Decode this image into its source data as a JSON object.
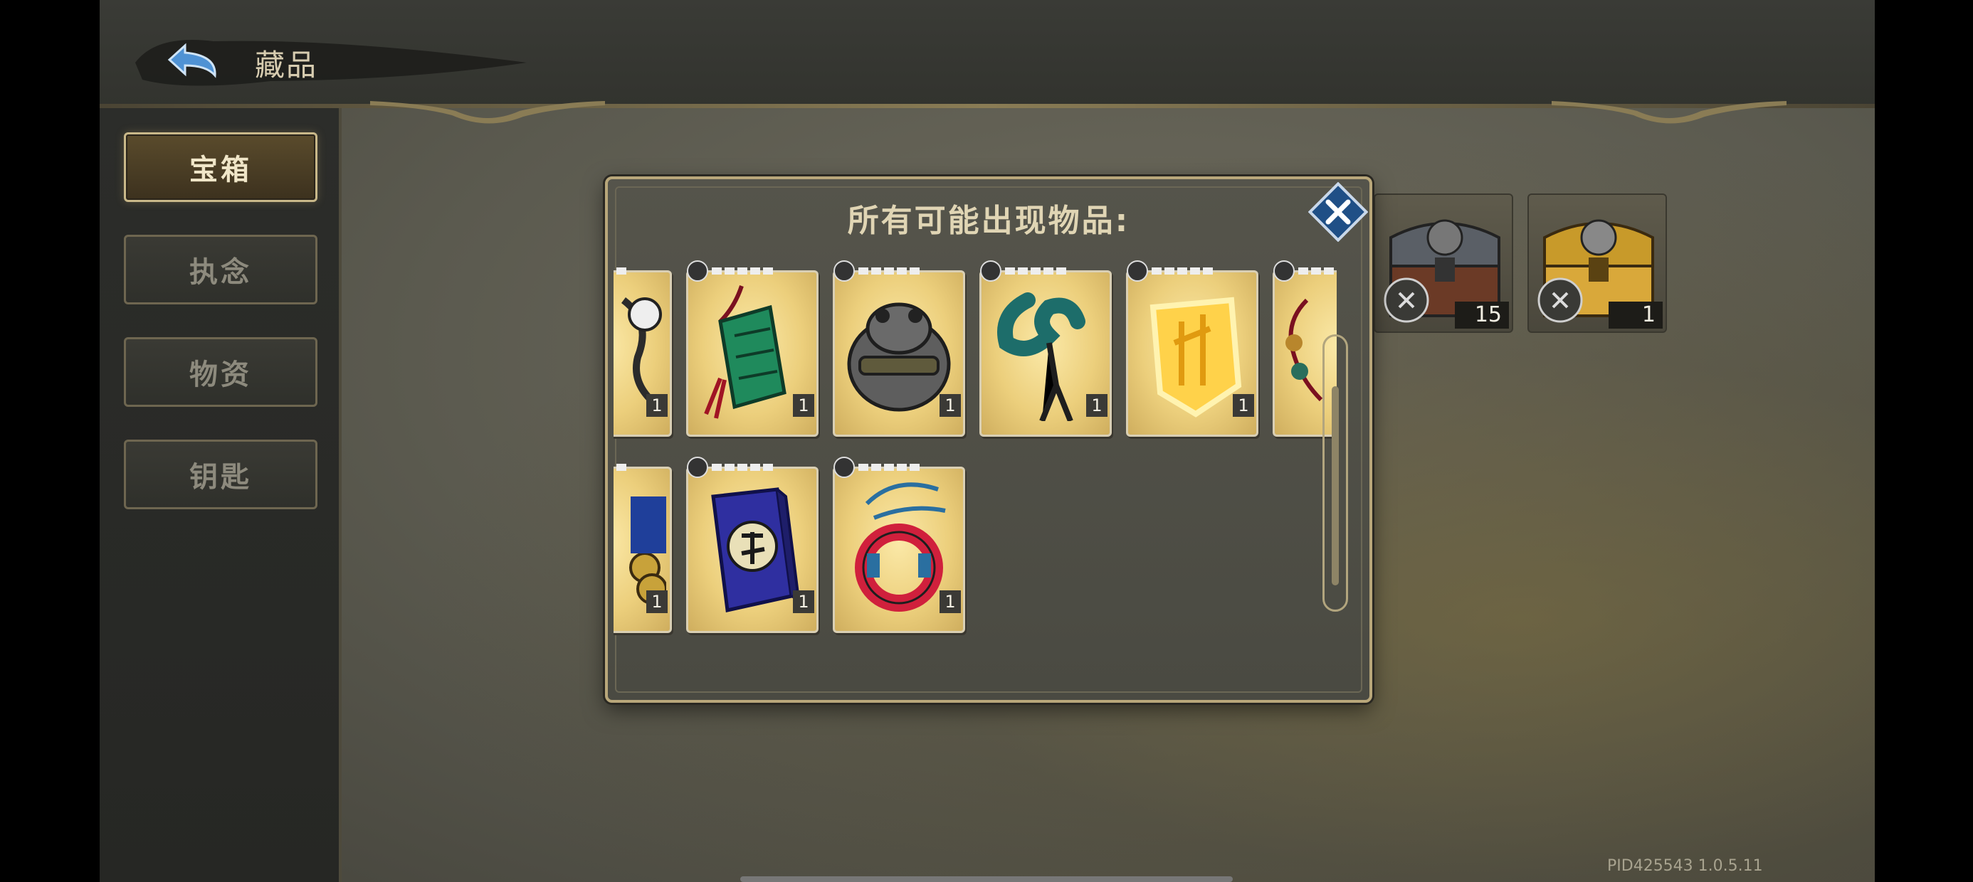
{
  "header": {
    "title": "藏品"
  },
  "sidebar": {
    "tabs": [
      {
        "label": "宝箱",
        "active": true
      },
      {
        "label": "执念",
        "active": false
      },
      {
        "label": "物资",
        "active": false
      },
      {
        "label": "钥匙",
        "active": false
      }
    ]
  },
  "chests": [
    {
      "name": "iron-chest",
      "count": "15"
    },
    {
      "name": "gold-chest",
      "count": "1"
    }
  ],
  "modal": {
    "title": "所有可能出现物品:",
    "items": [
      {
        "name": "skull-relic",
        "qty": "1",
        "rarity": 5
      },
      {
        "name": "jade-tablet",
        "qty": "1",
        "rarity": 5
      },
      {
        "name": "stone-toad",
        "qty": "1",
        "rarity": 5
      },
      {
        "name": "jade-hook",
        "qty": "1",
        "rarity": 5
      },
      {
        "name": "golden-talisman",
        "qty": "1",
        "rarity": 5
      },
      {
        "name": "bead-string",
        "qty": "1",
        "rarity": 5
      },
      {
        "name": "coin-stack",
        "qty": "1",
        "rarity": 5
      },
      {
        "name": "blue-book",
        "qty": "1",
        "rarity": 5
      },
      {
        "name": "red-ring",
        "qty": "1",
        "rarity": 5
      }
    ]
  },
  "footer": {
    "version": "PID425543  1.0.5.11"
  },
  "colors": {
    "accent": "#c9b889",
    "close": "#2a6fb0",
    "card": "#f2d98a"
  }
}
